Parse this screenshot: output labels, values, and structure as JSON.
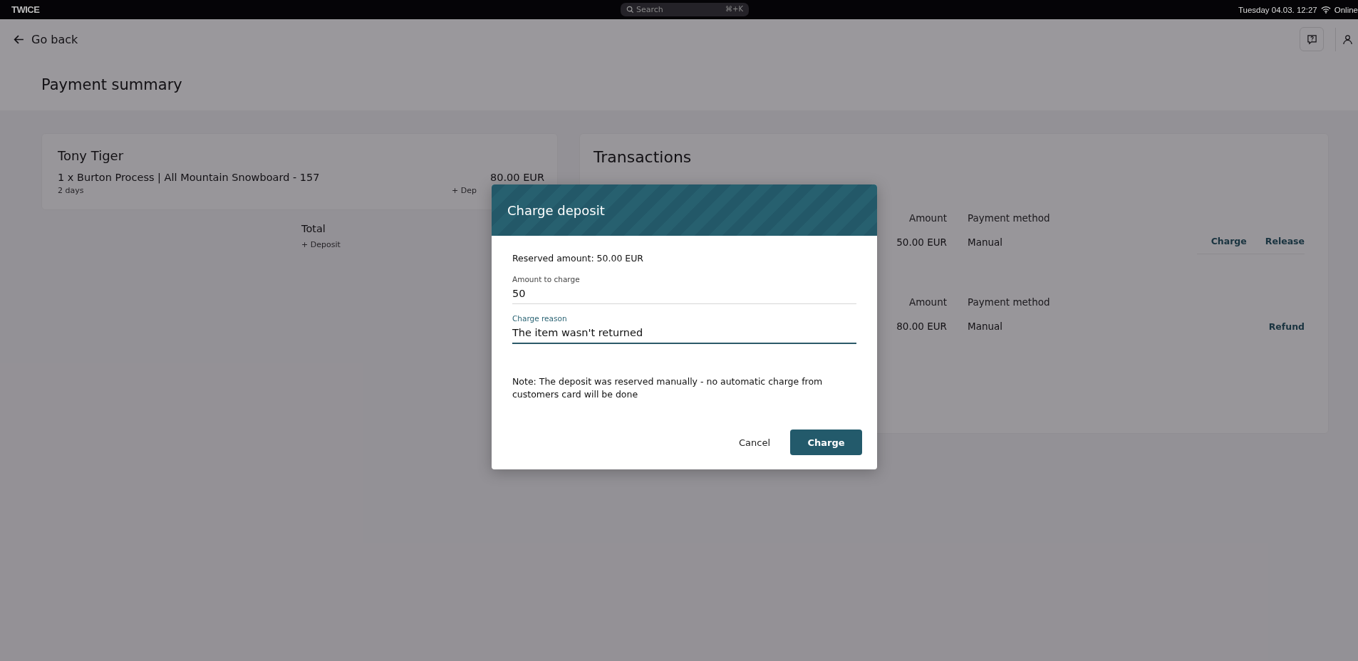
{
  "top_bar": {
    "logo": "TWICE",
    "search": {
      "placeholder": "Search",
      "shortcut": "⌘+K"
    },
    "datetime": "Tuesday 04.03. 12:27",
    "status": "Online"
  },
  "header": {
    "back": "Go back"
  },
  "page_title": "Payment summary",
  "order": {
    "customer": "Tony Tiger",
    "items": [
      {
        "name": "1 x Burton Process | All Mountain Snowboard - 157",
        "duration": "2 days",
        "price": "80.00 EUR",
        "deposit": "+ Dep"
      }
    ],
    "total_label": "Total",
    "total_deposit": "+ Deposit"
  },
  "transactions": {
    "title": "Transactions",
    "sections": [
      {
        "columns": [
          "Amount",
          "Payment method"
        ],
        "rows": [
          {
            "amount": "50.00 EUR",
            "method": "Manual",
            "actions": [
              "Charge",
              "Release"
            ]
          }
        ]
      },
      {
        "columns": [
          "Amount",
          "Payment method"
        ],
        "rows": [
          {
            "amount": "80.00 EUR",
            "method": "Manual",
            "actions": [
              "Refund"
            ]
          }
        ]
      }
    ]
  },
  "dialog": {
    "title": "Charge deposit",
    "reserved": "Reserved amount: 50.00 EUR",
    "fields": [
      {
        "label": "Amount to charge",
        "value": "50",
        "focused": false
      },
      {
        "label": "Charge reason",
        "value": "The item wasn't returned",
        "focused": true
      }
    ],
    "note": "Note: The deposit was reserved manually - no automatic charge from customers card will be done",
    "buttons": [
      {
        "label": "Cancel",
        "kind": "text"
      },
      {
        "label": "Charge",
        "kind": "primary"
      }
    ]
  }
}
